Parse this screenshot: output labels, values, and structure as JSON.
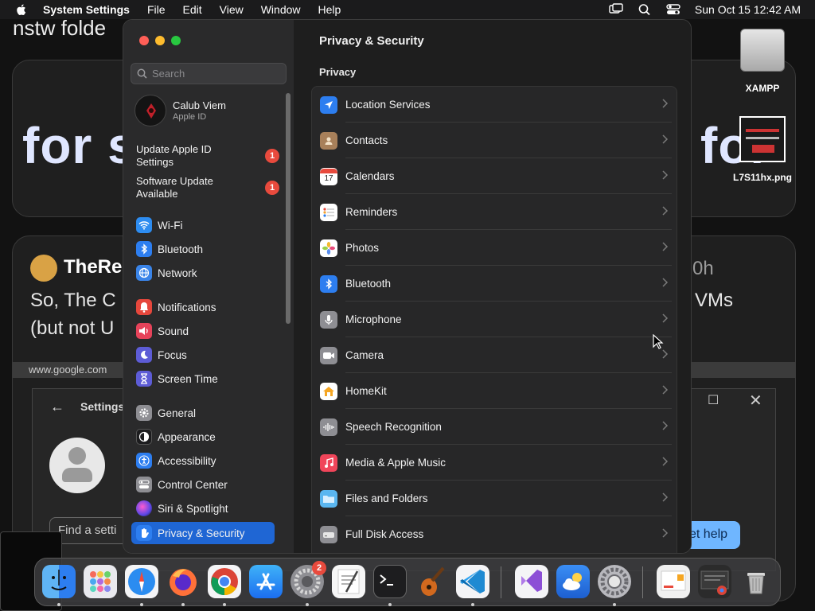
{
  "menubar": {
    "app_name": "System Settings",
    "menus": [
      "File",
      "Edit",
      "View",
      "Window",
      "Help"
    ],
    "clock": "Sun Oct 15  12:42 AM"
  },
  "background": {
    "tab_title": "nstw folde",
    "big_left": "for s",
    "big_right": "fol",
    "post_user": "TheRe",
    "post_time": "0h",
    "post_text_1": "So, The C",
    "post_text_2": "(but not U",
    "post_text_right": "VMs",
    "url": "www.google.com",
    "settings_title": "Settings",
    "find_setting": "Find a setti",
    "get_help": "et help"
  },
  "desktop": {
    "icons": [
      {
        "label": "XAMPP",
        "icon": "drive-icon"
      },
      {
        "label": "L7S11hx.png",
        "icon": "image-file-icon"
      }
    ]
  },
  "window": {
    "search_placeholder": "Search",
    "account": {
      "name": "Calub Viem",
      "sub": "Apple ID"
    },
    "updates": [
      {
        "label": "Update Apple ID Settings",
        "count": "1"
      },
      {
        "label": "Software Update Available",
        "count": "1"
      }
    ],
    "sidebar": [
      {
        "label": "Wi-Fi",
        "color": "#2d8cf0",
        "icon": "wifi-icon"
      },
      {
        "label": "Bluetooth",
        "color": "#2d7ef0",
        "icon": "bluetooth-icon"
      },
      {
        "label": "Network",
        "color": "#3a84e8",
        "icon": "globe-icon"
      },
      {
        "label": "Notifications",
        "color": "#e6473c",
        "icon": "bell-icon"
      },
      {
        "label": "Sound",
        "color": "#e6435a",
        "icon": "speaker-icon"
      },
      {
        "label": "Focus",
        "color": "#5d5cd6",
        "icon": "moon-icon"
      },
      {
        "label": "Screen Time",
        "color": "#5d5cd6",
        "icon": "hourglass-icon"
      },
      {
        "label": "General",
        "color": "#8e8e93",
        "icon": "gear-icon"
      },
      {
        "label": "Appearance",
        "color": "#1c1c1e",
        "icon": "appearance-icon"
      },
      {
        "label": "Accessibility",
        "color": "#2d7ef0",
        "icon": "accessibility-icon"
      },
      {
        "label": "Control Center",
        "color": "#8e8e93",
        "icon": "control-center-icon"
      },
      {
        "label": "Siri & Spotlight",
        "color": "#b04ad6",
        "icon": "siri-icon"
      },
      {
        "label": "Privacy & Security",
        "color": "#2d7ef0",
        "icon": "hand-icon"
      }
    ],
    "main_title": "Privacy & Security",
    "section": "Privacy",
    "rows": [
      {
        "label": "Location Services",
        "color": "#2d7ef0",
        "icon": "location-arrow-icon"
      },
      {
        "label": "Contacts",
        "color": "#a8805a",
        "icon": "contacts-icon"
      },
      {
        "label": "Calendars",
        "color": "#ffffff",
        "icon": "calendar-icon"
      },
      {
        "label": "Reminders",
        "color": "#ffffff",
        "icon": "reminders-icon"
      },
      {
        "label": "Photos",
        "color": "#ffffff",
        "icon": "photos-icon"
      },
      {
        "label": "Bluetooth",
        "color": "#2d7ef0",
        "icon": "bluetooth-icon"
      },
      {
        "label": "Microphone",
        "color": "#8e8e93",
        "icon": "microphone-icon"
      },
      {
        "label": "Camera",
        "color": "#8e8e93",
        "icon": "camera-icon"
      },
      {
        "label": "HomeKit",
        "color": "#ffffff",
        "icon": "home-icon"
      },
      {
        "label": "Speech Recognition",
        "color": "#8e8e93",
        "icon": "waveform-icon"
      },
      {
        "label": "Media & Apple Music",
        "color": "#f0455a",
        "icon": "music-note-icon"
      },
      {
        "label": "Files and Folders",
        "color": "#5ab6f0",
        "icon": "folder-icon"
      },
      {
        "label": "Full Disk Access",
        "color": "#8e8e93",
        "icon": "disk-icon"
      }
    ]
  },
  "dock": {
    "apps": [
      {
        "name": "finder-icon"
      },
      {
        "name": "launchpad-icon"
      },
      {
        "name": "safari-icon"
      },
      {
        "name": "firefox-icon"
      },
      {
        "name": "chrome-icon"
      },
      {
        "name": "app-store-icon"
      },
      {
        "name": "system-settings-icon",
        "badge": "2"
      },
      {
        "name": "textedit-icon"
      },
      {
        "name": "terminal-icon"
      },
      {
        "name": "garageband-icon"
      },
      {
        "name": "vscode-icon"
      },
      {
        "name": "visual-studio-icon"
      },
      {
        "name": "weather-icon"
      },
      {
        "name": "settings-gear-icon"
      },
      {
        "name": "recent-file-1-icon"
      },
      {
        "name": "recent-file-2-icon"
      },
      {
        "name": "trash-icon"
      }
    ]
  }
}
